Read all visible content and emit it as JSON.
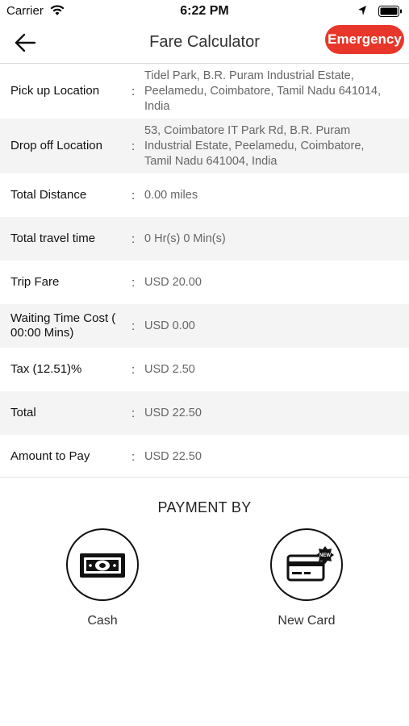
{
  "status_bar": {
    "carrier": "Carrier",
    "time": "6:22 PM"
  },
  "header": {
    "title": "Fare Calculator",
    "emergency_label": "Emergency"
  },
  "separator": ":",
  "rows": [
    {
      "label": "Pick up Location",
      "value": "Tidel Park, B.R. Puram Industrial Estate, Peelamedu, Coimbatore, Tamil Nadu 641014, India"
    },
    {
      "label": "Drop off Location",
      "value": "53, Coimbatore IT Park Rd, B.R. Puram Industrial Estate, Peelamedu, Coimbatore, Tamil Nadu 641004, India"
    },
    {
      "label": "Total Distance",
      "value": "0.00 miles"
    },
    {
      "label": "Total travel time",
      "value": "0 Hr(s) 0 Min(s)"
    },
    {
      "label": "Trip Fare",
      "value": "USD 20.00"
    },
    {
      "label": "Waiting Time Cost ( 00:00 Mins)",
      "value": "USD 0.00"
    },
    {
      "label": "Tax (12.51)%",
      "value": "USD 2.50"
    },
    {
      "label": "Total",
      "value": "USD 22.50"
    },
    {
      "label": "Amount to Pay",
      "value": "USD 22.50"
    }
  ],
  "payment": {
    "title": "PAYMENT BY",
    "options": [
      {
        "label": "Cash",
        "icon": "cash-icon"
      },
      {
        "label": "New Card",
        "icon": "new-card-icon",
        "badge": "NEW"
      }
    ]
  },
  "colors": {
    "emergency": "#e8372a",
    "alt_row": "#f4f4f4"
  }
}
